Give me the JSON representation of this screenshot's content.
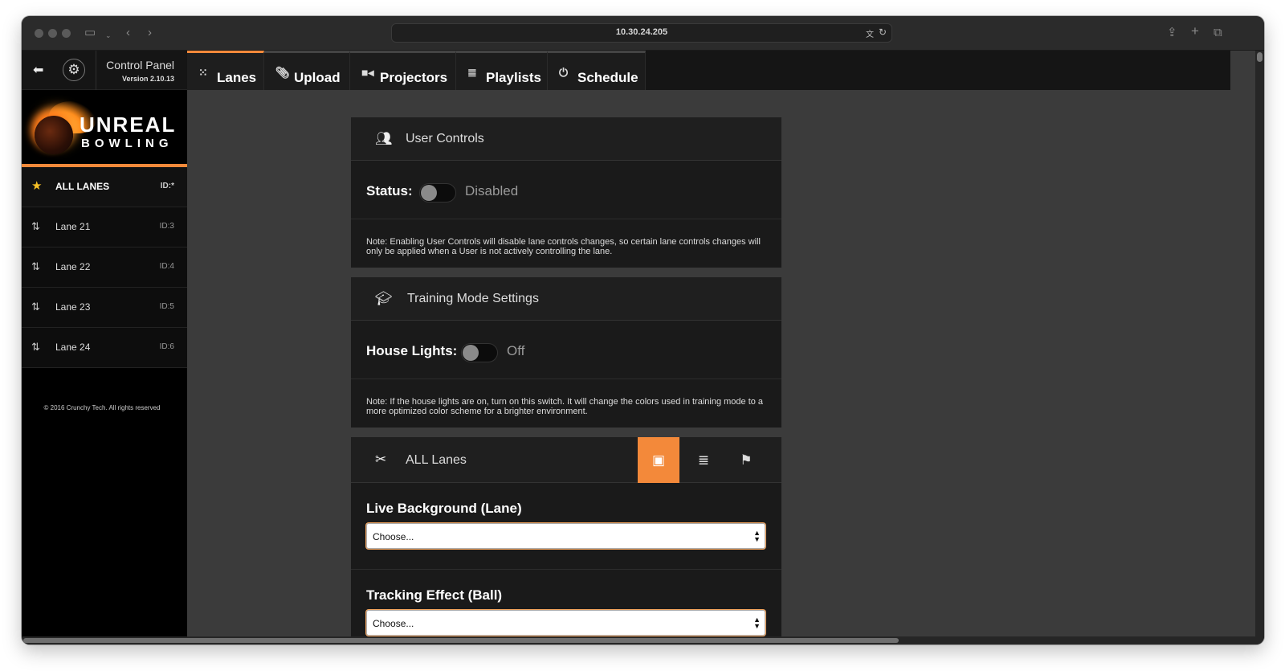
{
  "browser": {
    "url": "10.30.24.205"
  },
  "sidebar": {
    "control_panel_title": "Control Panel",
    "version": "Version 2.10.13",
    "logo_line1": "UNREAL",
    "logo_line2": "BOWLING",
    "items": [
      {
        "label": "ALL LANES",
        "id": "ID:*"
      },
      {
        "label": "Lane 21",
        "id": "ID:3"
      },
      {
        "label": "Lane 22",
        "id": "ID:4"
      },
      {
        "label": "Lane 23",
        "id": "ID:5"
      },
      {
        "label": "Lane 24",
        "id": "ID:6"
      }
    ],
    "copyright": "© 2016 Crunchy Tech. All rights reserved"
  },
  "tabs": [
    {
      "label": "Lanes",
      "icon": "grid-icon",
      "active": true
    },
    {
      "label": "Upload",
      "icon": "paperclip-icon"
    },
    {
      "label": "Projectors",
      "icon": "video-camera-icon"
    },
    {
      "label": "Playlists",
      "icon": "database-icon"
    },
    {
      "label": "Schedule",
      "icon": "power-icon"
    }
  ],
  "user_controls": {
    "title": "User Controls",
    "status_label": "Status:",
    "status_value": "Disabled",
    "enabled": false,
    "note": "Note: Enabling User Controls will disable lane controls changes, so certain lane controls changes will only be applied when a User is not actively controlling the lane."
  },
  "training_mode": {
    "title": "Training Mode Settings",
    "house_lights_label": "House Lights:",
    "house_lights_value": "Off",
    "enabled": false,
    "note": "Note: If the house lights are on, turn on this switch. It will change the colors used in training mode to a more optimized color scheme for a brighter environment."
  },
  "all_lanes": {
    "title": "ALL Lanes",
    "live_background_label": "Live Background (Lane)",
    "live_background_value": "Choose...",
    "tracking_effect_label": "Tracking Effect (Ball)",
    "tracking_effect_value": "Choose..."
  },
  "colors": {
    "accent": "#f3893a",
    "star": "#f6c026"
  }
}
